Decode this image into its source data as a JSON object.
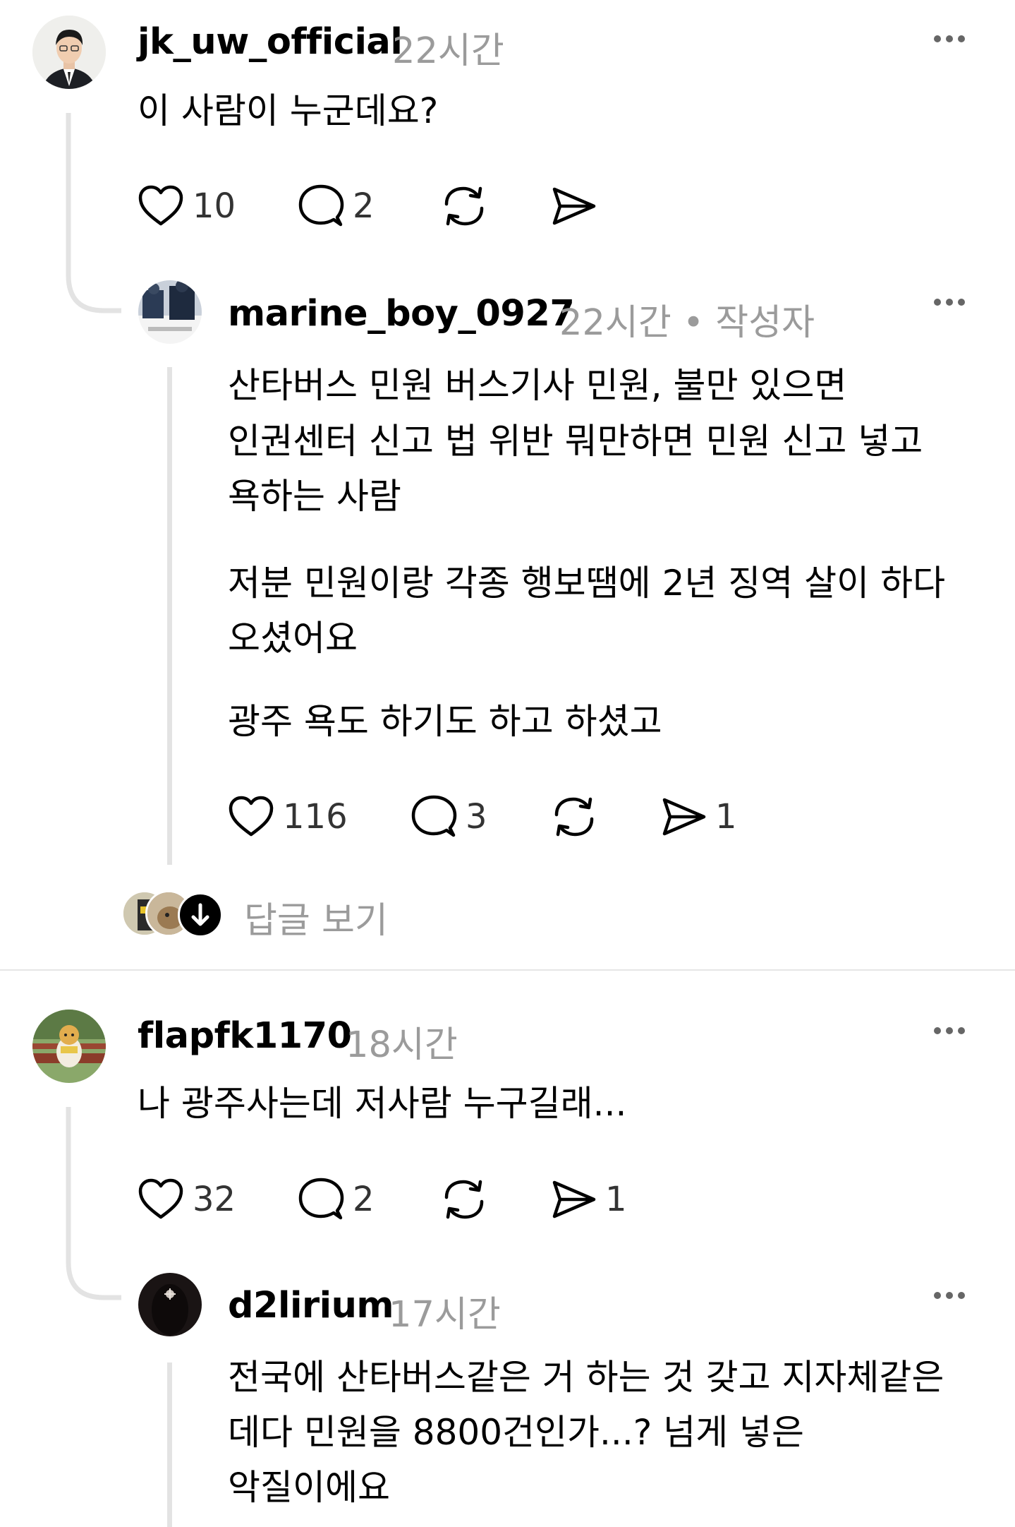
{
  "more_icon": "more-horizontal-icon",
  "colors": {
    "text": "#000000",
    "muted": "#9b9b9b",
    "thread_line": "#e3e3e3",
    "divider": "#e6e6e6"
  },
  "comments": [
    {
      "username": "jk_uw_official",
      "time": "22시간",
      "lines": [
        "이 사람이 누군데요?"
      ],
      "likes": "10",
      "replies": "2",
      "reposts": "",
      "shares": ""
    },
    {
      "username": "marine_boy_0927",
      "time": "22시간",
      "author_tag": "• 작성자",
      "lines": [
        "산타버스 민원 버스기사 민원, 불만 있으면",
        "인권센터 신고 법 위반 뭐만하면 민원 신고 넣고",
        "욕하는 사람",
        "저분 민원이랑 각종 행보땜에 2년 징역 살이 하다",
        "오셨어요",
        "광주 욕도 하기도 하고 하셨고"
      ],
      "likes": "116",
      "replies": "3",
      "reposts": "",
      "shares": "1"
    },
    {
      "username": "flapfk1170",
      "time": "18시간",
      "lines": [
        "나 광주사는데 저사람 누구길래..."
      ],
      "likes": "32",
      "replies": "2",
      "reposts": "",
      "shares": "1"
    },
    {
      "username": "d2lirium",
      "time": "17시간",
      "lines": [
        "전국에 산타버스같은 거 하는 것 갖고 지자체같은",
        "데다 민원을 8800건인가...? 넘게 넣은",
        "악질이에요"
      ]
    }
  ],
  "view_replies": "답글 보기"
}
